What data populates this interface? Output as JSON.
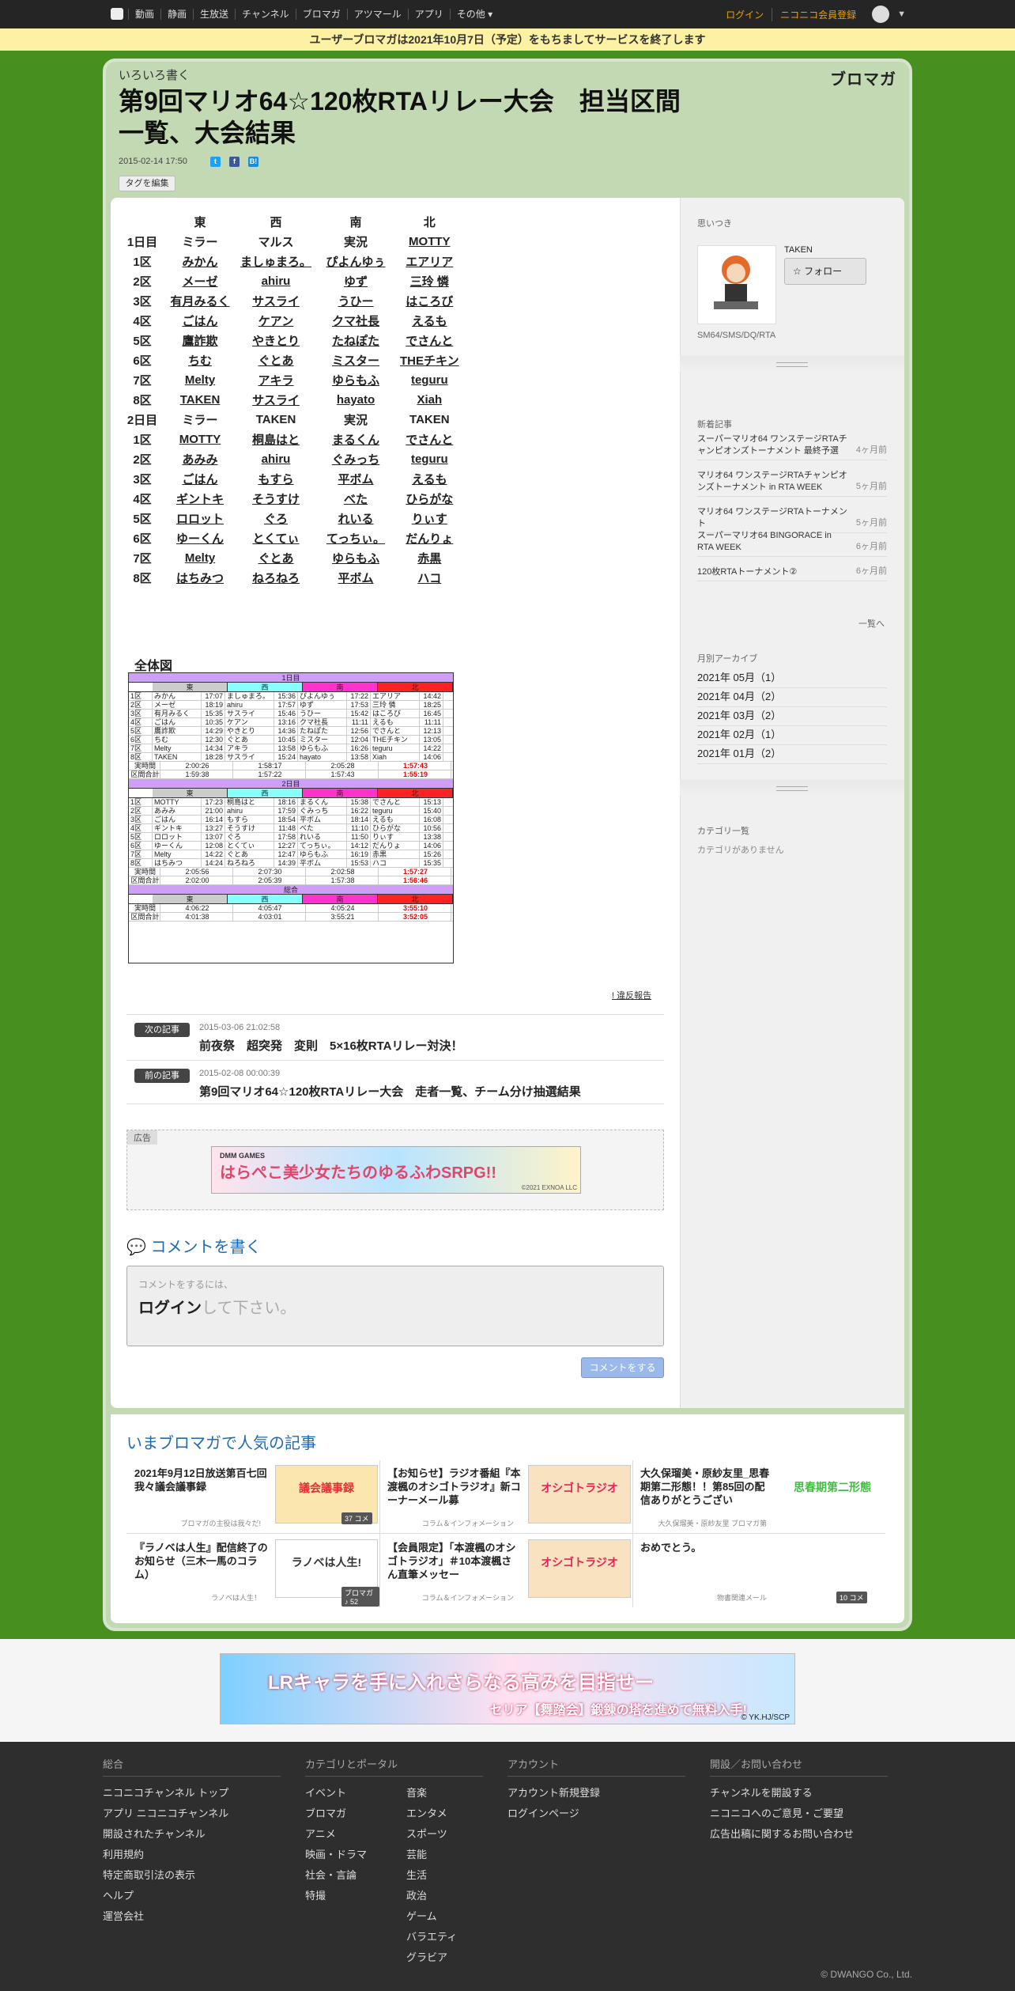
{
  "nav": {
    "items": [
      "動画",
      "静画",
      "生放送",
      "チャンネル",
      "ブロマガ",
      "アツマール",
      "アプリ",
      "その他"
    ],
    "login": "ログイン",
    "register": "ニコニコ会員登録"
  },
  "notice": "ユーザーブロマガは2021年10月7日（予定）をもちましてサービスを終了します",
  "header": {
    "blog_name": "いろいろ書く",
    "brand": "ブロマガ",
    "title": "第9回マリオ64☆120枚RTAリレー大会　担当区間一覧、大会結果",
    "date": "2015-02-14 17:50",
    "tag_button": "タグを編集"
  },
  "relay": {
    "columns": [
      "",
      "東",
      "西",
      "南",
      "北"
    ],
    "rows": [
      [
        "1日目",
        "ミラー",
        "マルス",
        "実況",
        "MOTTY"
      ],
      [
        "1区",
        "みかん",
        "ましゅまろ。",
        "ぴよんゆぅ",
        "エアリア"
      ],
      [
        "2区",
        "メーゼ",
        "ahiru",
        "ゆず",
        "三玲 憐"
      ],
      [
        "3区",
        "有月みるく",
        "サスライ",
        "うひー",
        "はころび"
      ],
      [
        "4区",
        "ごはん",
        "ケアン",
        "クマ社長",
        "えるも"
      ],
      [
        "5区",
        "鷹詐欺",
        "やきとり",
        "たねぽた",
        "でさんと"
      ],
      [
        "6区",
        "ちむ",
        "ぐとあ",
        "ミスター",
        "THEチキン"
      ],
      [
        "7区",
        "Melty",
        "アキラ",
        "ゆらもふ",
        "teguru"
      ],
      [
        "8区",
        "TAKEN",
        "サスライ",
        "hayato",
        "Xiah"
      ],
      [
        "2日目",
        "ミラー",
        "TAKEN",
        "実況",
        "TAKEN"
      ],
      [
        "1区",
        "MOTTY",
        "桐島はと",
        "まるくん",
        "でさんと"
      ],
      [
        "2区",
        "あみみ",
        "ahiru",
        "ぐみっち",
        "teguru"
      ],
      [
        "3区",
        "ごはん",
        "もすら",
        "平ボム",
        "えるも"
      ],
      [
        "4区",
        "ギントキ",
        "そうすけ",
        "べた",
        "ひらがな"
      ],
      [
        "5区",
        "ロロット",
        "ぐろ",
        "れいる",
        "りぃす"
      ],
      [
        "6区",
        "ゆーくん",
        "とくてぃ",
        "てっちぃ。",
        "だんりょ"
      ],
      [
        "7区",
        "Melty",
        "ぐとあ",
        "ゆらもふ",
        "赤黒"
      ],
      [
        "8区",
        "はちみつ",
        "ねろねろ",
        "平ボム",
        "ハコ"
      ]
    ]
  },
  "overview": {
    "title": "全体図",
    "day1": "1日目",
    "day2": "2日目",
    "total": "総合",
    "teams": [
      "東",
      "西",
      "南",
      "北"
    ],
    "day1_rows": [
      [
        "1区",
        "みかん",
        "17:07",
        "ましゅまろ。",
        "15:36",
        "ぴよんゆぅ",
        "17:22",
        "エアリア",
        "14:42"
      ],
      [
        "2区",
        "メーゼ",
        "18:19",
        "ahiru",
        "17:57",
        "ゆず",
        "17:53",
        "三玲 憐",
        "18:25"
      ],
      [
        "3区",
        "有月みるく",
        "15:35",
        "サスライ",
        "15:46",
        "うひー",
        "15:42",
        "はころび",
        "16:45"
      ],
      [
        "4区",
        "ごはん",
        "10:35",
        "ケアン",
        "13:16",
        "クマ社長",
        "11:11",
        "えるも",
        "11:11"
      ],
      [
        "5区",
        "鷹詐欺",
        "14:29",
        "やきとり",
        "14:36",
        "たねぽた",
        "12:56",
        "でさんと",
        "12:13"
      ],
      [
        "6区",
        "ちむ",
        "12:30",
        "ぐとあ",
        "10:45",
        "ミスター",
        "12:04",
        "THEチキン",
        "13:05"
      ],
      [
        "7区",
        "Melty",
        "14:34",
        "アキラ",
        "13:58",
        "ゆらもふ",
        "16:26",
        "teguru",
        "14:22"
      ],
      [
        "8区",
        "TAKEN",
        "18:28",
        "サスライ",
        "15:24",
        "hayato",
        "13:58",
        "Xiah",
        "14:06"
      ]
    ],
    "day1_sum": [
      [
        "実時間",
        "2:00:26",
        "1:58:17",
        "2:05:28",
        "1:57:43"
      ],
      [
        "区間合計",
        "1:59:38",
        "1:57:22",
        "1:57:43",
        "1:55:19"
      ]
    ],
    "day2_rows": [
      [
        "1区",
        "MOTTY",
        "17:23",
        "桐島はと",
        "18:16",
        "まるくん",
        "15:38",
        "でさんと",
        "15:13"
      ],
      [
        "2区",
        "あみみ",
        "21:00",
        "ahiru",
        "17:59",
        "ぐみっち",
        "16:22",
        "teguru",
        "15:40"
      ],
      [
        "3区",
        "ごはん",
        "16:14",
        "もすら",
        "18:54",
        "平ボム",
        "18:14",
        "えるも",
        "16:08"
      ],
      [
        "4区",
        "ギントキ",
        "13:27",
        "そうすけ",
        "11:48",
        "べた",
        "11:10",
        "ひらがな",
        "10:56"
      ],
      [
        "5区",
        "ロロット",
        "13:07",
        "ぐろ",
        "17:58",
        "れいる",
        "11:50",
        "りぃす",
        "13:38"
      ],
      [
        "6区",
        "ゆーくん",
        "12:08",
        "とくてぃ",
        "12:27",
        "てっちぃ。",
        "14:12",
        "だんりょ",
        "14:06"
      ],
      [
        "7区",
        "Melty",
        "14:22",
        "ぐとあ",
        "12:47",
        "ゆらもふ",
        "16:19",
        "赤黒",
        "15:26"
      ],
      [
        "8区",
        "はちみつ",
        "14:24",
        "ねろねろ",
        "14:39",
        "平ボム",
        "15:53",
        "ハコ",
        "15:35"
      ]
    ],
    "day2_sum": [
      [
        "実時間",
        "2:05:56",
        "2:07:30",
        "2:02:58",
        "1:57:27"
      ],
      [
        "区間合計",
        "2:02:00",
        "2:05:39",
        "1:57:38",
        "1:56:46"
      ]
    ],
    "total_sum": [
      [
        "実時間",
        "4:06:22",
        "4:05:47",
        "4:05:24",
        "3:55:10"
      ],
      [
        "区間合計",
        "4:01:38",
        "4:03:01",
        "3:55:21",
        "3:52:05"
      ]
    ]
  },
  "report": "! 違反報告",
  "next": {
    "tag": "次の記事",
    "date": "2015-03-06 21:02:58",
    "title": "前夜祭　超突発　変則　5×16枚RTAリレー対決！"
  },
  "prev": {
    "tag": "前の記事",
    "date": "2015-02-08 00:00:39",
    "title": "第9回マリオ64☆120枚RTAリレー大会　走者一覧、チーム分け抽選結果"
  },
  "ad": {
    "label": "広告",
    "text": "はらぺこ美少女たちのゆるふわSRPG!!",
    "maker": "DMM GAMES",
    "copyright": "©2021 EXNOA LLC"
  },
  "comment": {
    "heading": "コメントを書く",
    "hint": "コメントをするには、",
    "login": "ログイン",
    "login_suffix": "して下さい。",
    "button": "コメントをする"
  },
  "sidebar": {
    "section": "思いつき",
    "author": "TAKEN",
    "follow": "フォロー",
    "desc": "SM64/SMS/DQ/RTA",
    "new_title": "新着記事",
    "new_items": [
      {
        "title": "スーパーマリオ64 ワンステージRTAチャンピオンズトーナメント 最終予選",
        "ago": "4ヶ月前"
      },
      {
        "title": "マリオ64 ワンステージRTAチャンピオンズトーナメント in RTA WEEK",
        "ago": "5ヶ月前"
      },
      {
        "title": "マリオ64 ワンステージRTAトーナメント",
        "ago": "5ヶ月前"
      },
      {
        "title": "スーパーマリオ64 BINGORACE in RTA WEEK",
        "ago": "6ヶ月前"
      },
      {
        "title": "120枚RTAトーナメント②",
        "ago": "6ヶ月前"
      }
    ],
    "list_link": "一覧へ",
    "archive_title": "月別アーカイブ",
    "archive": [
      "2021年 05月（1）",
      "2021年 04月（2）",
      "2021年 03月（2）",
      "2021年 02月（1）",
      "2021年 01月（2）"
    ],
    "category_title": "カテゴリ一覧",
    "category_empty": "カテゴリがありません"
  },
  "popular": {
    "title": "いまブロマガで人気の記事",
    "items": [
      {
        "title": "2021年9月12日放送第百七回我々議会議事録",
        "source": "ブロマガの主役は我々だ!",
        "img": "議会議事録",
        "count": "37 コメ"
      },
      {
        "title": "【お知らせ】ラジオ番組『本渡楓のオシゴトラジオ』新コーナーメール募",
        "source": "コラム＆インフォメーション",
        "img": "オシゴトラジオ",
        "count": ""
      },
      {
        "title": "大久保瑠美・原紗友里_思春期第二形態！！第85回の配信ありがとうござい",
        "source": "大久保瑠美・原紗友里 ブロマガ第",
        "img": "思春期第二形態",
        "count": ""
      },
      {
        "title": "『ラノベは人生』配信終了のお知らせ（三木一馬のコラム）",
        "source": "ラノベは人生！",
        "img": "ラノベは人生!",
        "count": "ブロマガ ♪ 52"
      },
      {
        "title": "【会員限定】「本渡楓のオシゴトラジオ」＃10本渡楓さん直筆メッセー",
        "source": "コラム＆インフォメーション",
        "img": "オシゴトラジオ",
        "count": ""
      },
      {
        "title": "おめでとう。",
        "source": "物書関連メール",
        "img": "",
        "count": "10 コメ"
      }
    ]
  },
  "banner": {
    "text": "LRキャラを手に入れさらなる高みを目指せー",
    "text2": "セリア【舞踏会】鍛錬の塔を進めて無料入手!",
    "copyright": "© YK.HJ/SCP"
  },
  "footer": {
    "cols": [
      {
        "head": "総合",
        "links": [
          "ニコニコチャンネル トップ",
          "アプリ ニコニコチャンネル",
          "開設されたチャンネル",
          "利用規約",
          "特定商取引法の表示",
          "ヘルプ",
          "運営会社"
        ]
      },
      {
        "head": "カテゴリとポータル",
        "links": [
          "イベント",
          "ブロマガ",
          "アニメ",
          "映画・ドラマ",
          "社会・言論",
          "特撮"
        ],
        "links2": [
          "音楽",
          "エンタメ",
          "スポーツ",
          "芸能",
          "生活",
          "政治",
          "ゲーム",
          "バラエティ",
          "グラビア"
        ]
      },
      {
        "head": "アカウント",
        "links": [
          "アカウント新規登録",
          "ログインページ"
        ]
      },
      {
        "head": "開設／お問い合わせ",
        "links": [
          "チャンネルを開設する",
          "ニコニコへのご意見・ご要望",
          "広告出稿に関するお問い合わせ"
        ]
      }
    ],
    "copyright": "© DWANGO Co., Ltd."
  }
}
